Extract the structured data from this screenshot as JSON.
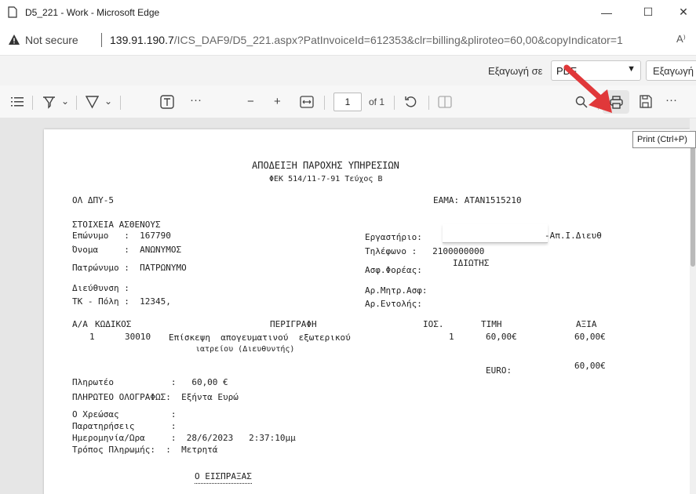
{
  "window": {
    "title": "D5_221 - Work - Microsoft Edge",
    "minimize_glyph": "—",
    "maximize_glyph": "☐",
    "close_glyph": "✕"
  },
  "address": {
    "security_label": "Not secure",
    "url_host": "139.91.190.7",
    "url_path": "/ICS_DAF9/D5_221.aspx?PatInvoiceId=612353&clr=billing&pliroteo=60,00&copyIndicator=1",
    "read_aloud": "A⁾"
  },
  "export": {
    "label": "Εξαγωγή σε",
    "format_value": "PDF",
    "button_label": "Εξαγωγή"
  },
  "pdf_toolbar": {
    "minus": "−",
    "plus": "+",
    "page_number": "1",
    "page_total": "of 1",
    "tooltip": "Print (Ctrl+P)"
  },
  "document": {
    "title": "ΑΠΟΔΕΙΞΗ ΠΑΡΟΧΗΣ ΥΠΗΡΕΣΙΩΝ",
    "subtitle": "ΦΕΚ 514/11-7-91 Τεύχος Β",
    "org": "ΟΛ ΔΠΥ-5",
    "eama": "ΕΑΜΑ: ΑΤΑΝ1515210",
    "patient_section": "ΣΤΟΙΧΕΙΑ ΑΣΘΕΝΟΥΣ",
    "surname": "Επώνυμο   :  167790",
    "name": "Όνομα     :  ΑΝΩΝΥΜΟΣ",
    "patronymic": "Πατρώνυμο :  ΠΑΤΡΩΝΥΜΟ",
    "address": "Διεύθυνση :",
    "postcode": "ΤΚ - Πόλη :  12345,",
    "lab_label": "Εργαστήριο:",
    "lab_value": "-Απ.Ι.Διευθ",
    "phone": "Τηλέφωνο :   2100000000",
    "insurer_label": "Ασφ.Φορέας:",
    "insurer_value": "ΙΔΙΩΤΗΣ",
    "insurance_no": "Αρ.Μητρ.Ασφ:",
    "order_no": "Αρ.Εντολής:",
    "col_aa": "Α/Α",
    "col_code": "ΚΩΔΙΚΟΣ",
    "col_desc": "ΠΕΡΙΓΡΑΦΗ",
    "col_qty": "ΙΟΣ.",
    "col_price": "ΤΙΜΗ",
    "col_value": "ΑΞΙΑ",
    "row_aa": "1",
    "row_code": "30010",
    "row_desc_1": "Επίσκεψη  απογευματινού  εξωτερικού",
    "row_desc_2": "ιατρείου (Διευθυντής)",
    "row_qty": "1",
    "row_price": "60,00€",
    "row_value": "60,00€",
    "euro_label": "EURO:",
    "euro_total": "60,00€",
    "payable": "Πληρωτέο           :   60,00 €",
    "payable_words": "ΠΛΗΡΩΤΕΟ ΟΛΟΓΡΑΦΩΣ:  Εξήντα Ευρώ",
    "debtor": "Ο Χρεώσας          :",
    "remarks": "Παρατηρήσεις       :",
    "datetime": "Ημερομηνία/Ωρα     :  28/6/2023   2:37:10μμ",
    "payment_method": "Τρόπος Πληρωμής:  :  Μετρητά",
    "cashier": "Ο ΕΙΣΠΡΑΞΑΣ"
  },
  "colors": {
    "arrow": "#e0383a",
    "viewer_bg": "#e6e6e6"
  }
}
